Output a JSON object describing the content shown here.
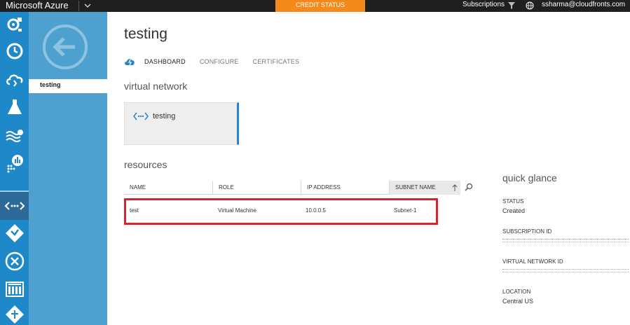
{
  "topbar": {
    "brand": "Microsoft Azure",
    "credit_status": "CREDIT STATUS",
    "subscriptions": "Subscriptions",
    "user": "ssharma@cloudfronts.com"
  },
  "rail": {
    "items": [
      {
        "icon": "gear-cloud-icon"
      },
      {
        "icon": "clock-icon"
      },
      {
        "icon": "cloud-icon"
      },
      {
        "icon": "flask-icon"
      },
      {
        "icon": "wave-gear-icon"
      },
      {
        "icon": "chart-icon"
      },
      {
        "icon": "virtual-network-icon",
        "active": true
      },
      {
        "icon": "traffic-manager-icon"
      },
      {
        "icon": "remote-app-icon"
      },
      {
        "icon": "dashboard-grid-icon"
      },
      {
        "icon": "gateway-icon"
      }
    ]
  },
  "subnav": {
    "item_label": "testing"
  },
  "main": {
    "title": "testing",
    "tabs": [
      {
        "label": "DASHBOARD",
        "active": true
      },
      {
        "label": "CONFIGURE",
        "active": false
      },
      {
        "label": "CERTIFICATES",
        "active": false
      }
    ],
    "virtual_network_heading": "virtual network",
    "vnet_tile_label": "testing",
    "resources_heading": "resources",
    "table": {
      "columns": [
        "NAME",
        "ROLE",
        "IP ADDRESS",
        "SUBNET NAME"
      ],
      "rows": [
        {
          "name": "test",
          "role": "Virtual Machine",
          "ip": "10.0.0.5",
          "subnet": "Subnet-1"
        }
      ]
    }
  },
  "quick_glance": {
    "title": "quick glance",
    "status_label": "STATUS",
    "status_value": "Created",
    "subscription_id_label": "SUBSCRIPTION ID",
    "virtual_network_id_label": "VIRTUAL NETWORK ID",
    "location_label": "LOCATION",
    "location_value": "Central US"
  },
  "colors": {
    "topbar": "#1f1f1f",
    "credit": "#f48a1c",
    "rail": "#1e88c9",
    "subnav": "#4ea0cf",
    "highlight": "#d9242f"
  }
}
